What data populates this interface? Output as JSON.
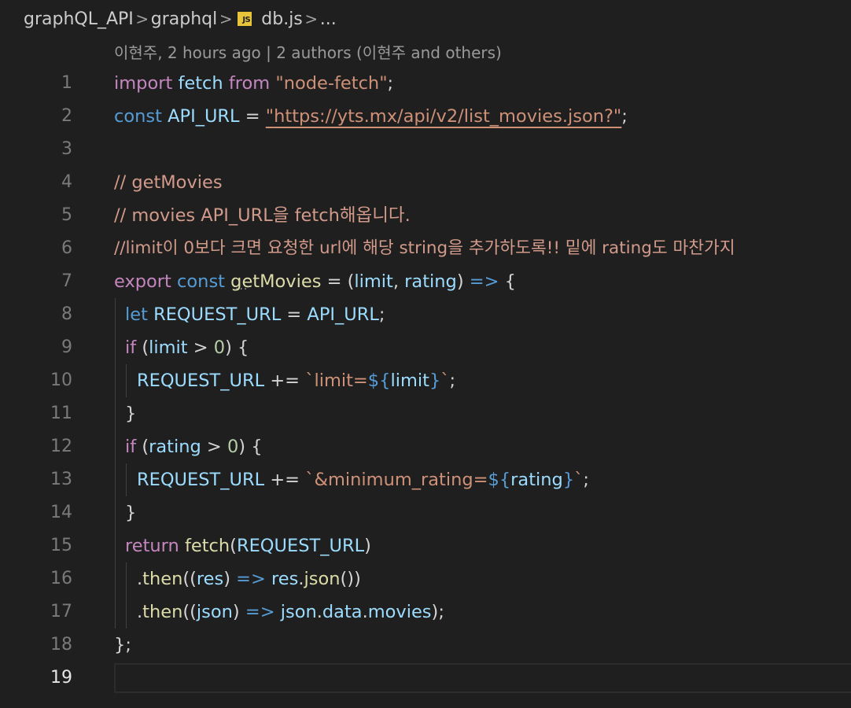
{
  "breadcrumb": {
    "items": [
      "graphQL_API",
      "graphql",
      "db.js",
      "..."
    ],
    "separator": ">",
    "file_icon": "JS"
  },
  "blame": {
    "text": "이현주, 2 hours ago | 2 authors (이현주 and others)"
  },
  "active_line": "19",
  "line_numbers": [
    "1",
    "2",
    "3",
    "4",
    "5",
    "6",
    "7",
    "8",
    "9",
    "10",
    "11",
    "12",
    "13",
    "14",
    "15",
    "16",
    "17",
    "18",
    "19"
  ],
  "code": {
    "l1": {
      "t0": "import",
      "t1": " ",
      "t2": "fetch",
      "t3": " ",
      "t4": "from",
      "t5": " ",
      "t6": "\"node-fetch\"",
      "t7": ";"
    },
    "l2": {
      "t0": "const",
      "t1": " ",
      "t2": "API_URL",
      "t3": " = ",
      "t4": "\"",
      "t5": "https://yts.mx/api/v2/list_movies.json?",
      "t6": "\"",
      "t7": ";"
    },
    "l4": {
      "t0": "// getMovies"
    },
    "l5": {
      "t0": "// movies API_URL을 fetch해옵니다."
    },
    "l6": {
      "t0": "//limit이 0보다 크면 요청한 url에 해당 string을 추가하도록!! 밑에 rating도 마찬가지"
    },
    "l7": {
      "t0": "export",
      "t1": " ",
      "t2": "const",
      "t3": " ",
      "t4": "getMovies",
      "t5": " = (",
      "t6": "limit",
      "t7": ", ",
      "t8": "rating",
      "t9": ") ",
      "t10": "=>",
      "t11": " {"
    },
    "l8": {
      "t0": "let",
      "t1": " ",
      "t2": "REQUEST_URL",
      "t3": " = ",
      "t4": "API_URL",
      "t5": ";"
    },
    "l9": {
      "t0": "if",
      "t1": " (",
      "t2": "limit",
      "t3": " > ",
      "t4": "0",
      "t5": ") {"
    },
    "l10": {
      "t0": "REQUEST_URL",
      "t1": " += ",
      "t2": "`limit=",
      "t3": "${",
      "t4": "limit",
      "t5": "}",
      "t6": "`",
      "t7": ";"
    },
    "l11": {
      "t0": "}"
    },
    "l12": {
      "t0": "if",
      "t1": " (",
      "t2": "rating",
      "t3": " > ",
      "t4": "0",
      "t5": ") {"
    },
    "l13": {
      "t0": "REQUEST_URL",
      "t1": " += ",
      "t2": "`&minimum_rating=",
      "t3": "${",
      "t4": "rating",
      "t5": "}",
      "t6": "`",
      "t7": ";"
    },
    "l14": {
      "t0": "}"
    },
    "l15": {
      "t0": "return",
      "t1": " ",
      "t2": "fetch",
      "t3": "(",
      "t4": "REQUEST_URL",
      "t5": ")"
    },
    "l16": {
      "t0": ".",
      "t1": "then",
      "t2": "((",
      "t3": "res",
      "t4": ") ",
      "t5": "=>",
      "t6": " ",
      "t7": "res",
      "t8": ".",
      "t9": "json",
      "t10": "())"
    },
    "l17": {
      "t0": ".",
      "t1": "then",
      "t2": "((",
      "t3": "json",
      "t4": ") ",
      "t5": "=>",
      "t6": " ",
      "t7": "json",
      "t8": ".",
      "t9": "data",
      "t10": ".",
      "t11": "movies",
      "t12": ");"
    },
    "l18": {
      "t0": "};"
    }
  },
  "colors": {
    "background": "#1f1f1f",
    "keyword_control": "#c586c0",
    "keyword_storage": "#569cd6",
    "identifier": "#9cdcfe",
    "function": "#dcdcaa",
    "string": "#ce9178",
    "number": "#b5cea8",
    "comment": "#d29a8a"
  }
}
